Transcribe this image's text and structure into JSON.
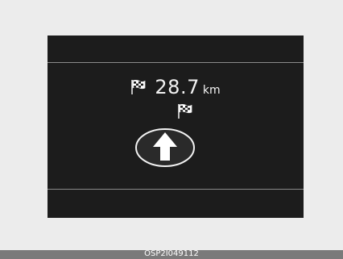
{
  "cluster": {
    "distance_value": "28.7",
    "distance_unit": "km"
  },
  "icons": {
    "distance_flag": "checkered-flag-icon",
    "destination_flag": "checkered-flag-icon",
    "direction": "straight-ahead-arrow-icon"
  },
  "caption": {
    "code": "OSP2I049112"
  },
  "colors": {
    "display_background": "#1c1c1c",
    "text": "#f2f2f2",
    "caption_bar": "#7a7a7a"
  }
}
